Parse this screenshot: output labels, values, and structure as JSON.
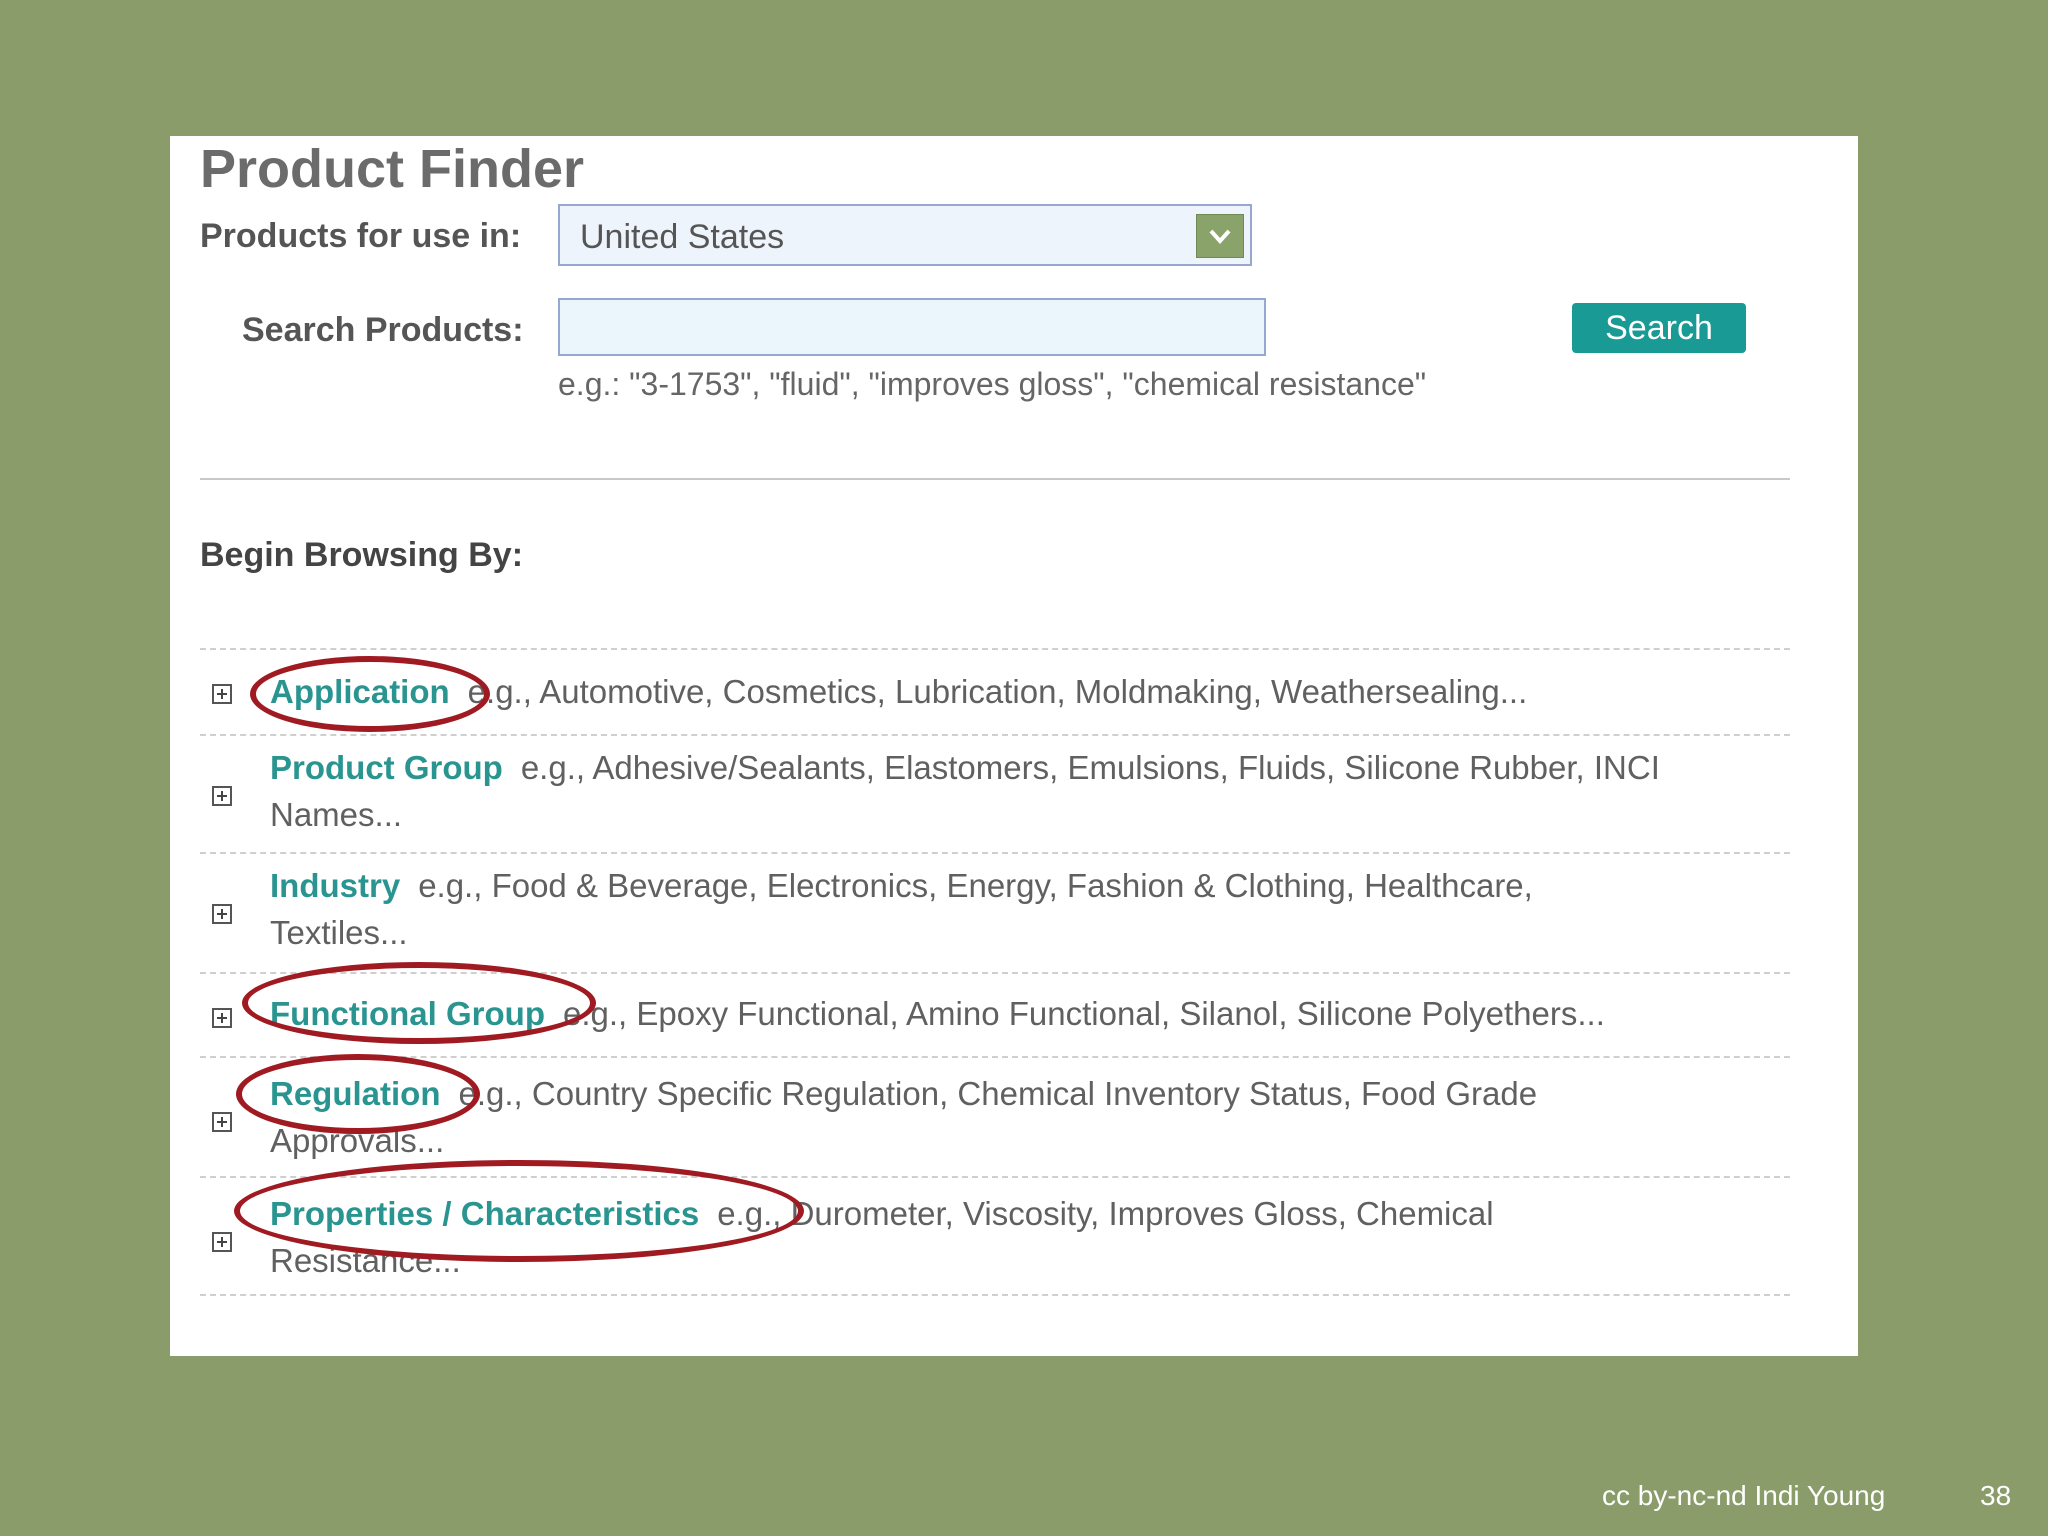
{
  "app": {
    "title": "Product Finder"
  },
  "filters": {
    "use_in_label": "Products for use in:",
    "use_in_value": "United States",
    "search_label": "Search Products:",
    "search_value": "",
    "search_button": "Search",
    "search_hint": "e.g.: \"3-1753\", \"fluid\", \"improves gloss\", \"chemical resistance\""
  },
  "browse": {
    "title": "Begin Browsing By:",
    "items": [
      {
        "label": "Application",
        "description": "e.g., Automotive, Cosmetics, Lubrication, Moldmaking, Weathersealing..."
      },
      {
        "label": "Product Group",
        "description": "e.g., Adhesive/Sealants, Elastomers, Emulsions, Fluids, Silicone Rubber, INCI Names..."
      },
      {
        "label": "Industry",
        "description": "e.g., Food & Beverage, Electronics, Energy, Fashion & Clothing, Healthcare, Textiles..."
      },
      {
        "label": "Functional Group",
        "description": "e.g., Epoxy Functional, Amino Functional, Silanol, Silicone Polyethers..."
      },
      {
        "label": "Regulation",
        "description": "e.g., Country Specific Regulation, Chemical Inventory Status, Food Grade Approvals..."
      },
      {
        "label": "Properties / Characteristics",
        "description": "e.g., Durometer, Viscosity, Improves Gloss, Chemical Resistance..."
      }
    ]
  },
  "annotations": {
    "highlight_color": "#a01a21",
    "circled_items": [
      "Application",
      "Functional Group",
      "Regulation",
      "Properties / Characteristics"
    ]
  },
  "footer": {
    "credit": "cc by-nc-nd Indi Young",
    "page_number": "38"
  }
}
